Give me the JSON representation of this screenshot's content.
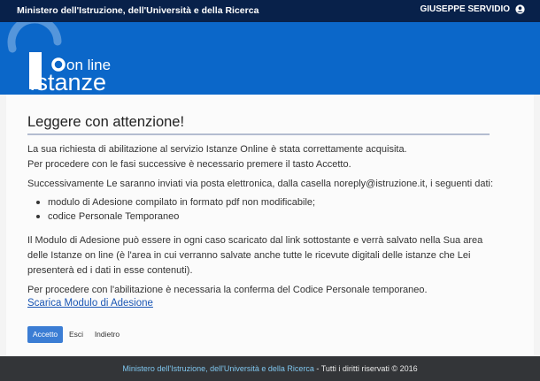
{
  "topbar": {
    "ministry": "Ministero dell'Istruzione, dell'Università e della Ricerca",
    "user_name": "GIUSEPPE SERVIDIO",
    "user_icon": "user-circle-icon"
  },
  "logo": {
    "line1": "on line",
    "line2": "Istanze"
  },
  "main": {
    "title": "Leggere con attenzione!",
    "paragraphs": [
      "La sua richiesta di abilitazione al servizio Istanze Online è stata correttamente acquisita.",
      "Per procedere con le fasi successive è necessario premere il tasto Accetto.",
      "Successivamente Le saranno inviati via posta elettronica, dalla casella noreply@istruzione.it, i seguenti dati:"
    ],
    "bullets": [
      "modulo di Adesione compilato in formato pdf non modificabile;",
      "codice Personale Temporaneo"
    ],
    "paragraph2": [
      "Il Modulo di Adesione può essere in ogni caso scaricato dal link sottostante e verrà salvato nella Sua area",
      "delle Istanze on line (è l'area in cui verranno salvate anche tutte le ricevute digitali delle istanze che Lei",
      "presenterà ed i dati in esse contenuti)."
    ],
    "paragraph3": "Per procedere con l'abilitazione è necessaria la conferma del Codice Personale temporaneo.",
    "download_link": "Scarica Modulo di Adesione",
    "buttons": {
      "accetto": "Accetto",
      "esci": "Esci",
      "indietro": "Indietro"
    }
  },
  "footer": {
    "ministry": "Ministero dell'Istruzione, dell'Università e della Ricerca",
    "rights": " - Tutti i diritti riservati © 2016"
  },
  "colors": {
    "topbar": "#08214a",
    "banner": "#0b67c9",
    "primary_button": "#3b7dd4",
    "link": "#1a56b4",
    "footer": "#333538"
  }
}
